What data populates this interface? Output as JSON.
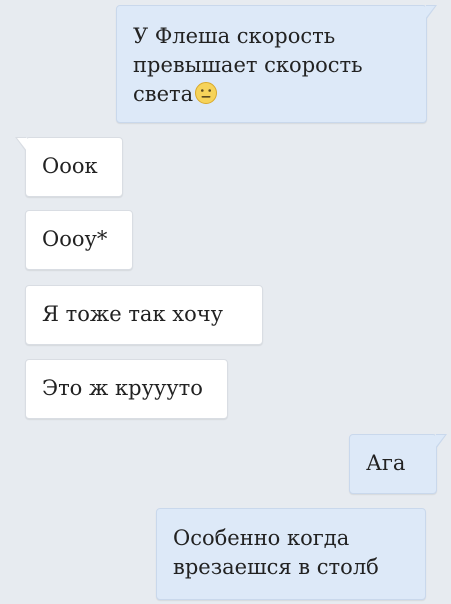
{
  "colors": {
    "background": "#e7ebf0",
    "incoming_bubble": "#ffffff",
    "outgoing_bubble": "#dde9f8"
  },
  "messages": [
    {
      "direction": "outgoing",
      "text": "У Флеша скорость\nпревышает скорость\nсвета",
      "emoji": "neutral-face-emoji"
    },
    {
      "direction": "incoming",
      "text": "Ооок"
    },
    {
      "direction": "incoming",
      "text": "Оооу*"
    },
    {
      "direction": "incoming",
      "text": "Я тоже так хочу"
    },
    {
      "direction": "incoming",
      "text": "Это ж круууто"
    },
    {
      "direction": "outgoing",
      "text": "Ага"
    },
    {
      "direction": "outgoing",
      "text": "Особенно когда\nврезаешся в столб"
    }
  ]
}
